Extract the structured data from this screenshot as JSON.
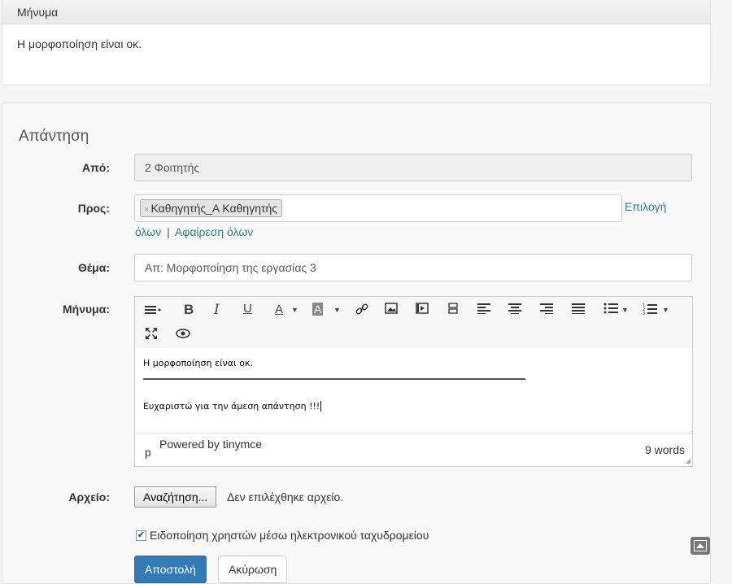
{
  "message_panel": {
    "heading": "Μήνυμα",
    "body": "Η μορφοποίηση είναι οκ."
  },
  "reply": {
    "legend": "Απάντηση",
    "from": {
      "label": "Από:",
      "value": "2 Φοιτητής"
    },
    "to": {
      "label": "Προς:",
      "tags": [
        "Καθηγητής_Α Καθηγητής"
      ],
      "select_all_part1": "Επιλογή",
      "select_all_part2": "όλων",
      "separator": "|",
      "remove_all": "Αφαίρεση όλων"
    },
    "subject": {
      "label": "Θέμα:",
      "value": "Απ: Μορφοποίηση της εργασίας 3"
    },
    "message": {
      "label": "Μήνυμα:",
      "line1": "Η μορφοποίηση είναι οκ.",
      "line2": "Ευχαριστώ για την άμεση απάντηση !!!",
      "path": "p",
      "powered_by": "Powered by tinymce",
      "word_count": "9 words"
    },
    "toolbar_icons": [
      "paragraph-format-icon",
      "bold-icon",
      "italic-icon",
      "underline-icon",
      "text-color-icon",
      "background-color-icon",
      "link-icon",
      "image-icon",
      "media-icon",
      "page-break-icon",
      "align-left-icon",
      "align-center-icon",
      "align-right-icon",
      "align-justify-icon",
      "bullet-list-icon",
      "numbered-list-icon",
      "fullscreen-icon",
      "preview-icon"
    ],
    "file": {
      "label": "Αρχείο:",
      "browse_button": "Αναζήτηση...",
      "status": "Δεν επιλέχθηκε αρχείο."
    },
    "notify": {
      "checked": true,
      "label": "Ειδοποίηση χρηστών μέσω ηλεκτρονικού ταχυδρομείου"
    },
    "send_button": "Αποστολή",
    "cancel_button": "Ακύρωση"
  },
  "colors": {
    "link": "#2a7d8c",
    "primary": "#2e6da4"
  }
}
